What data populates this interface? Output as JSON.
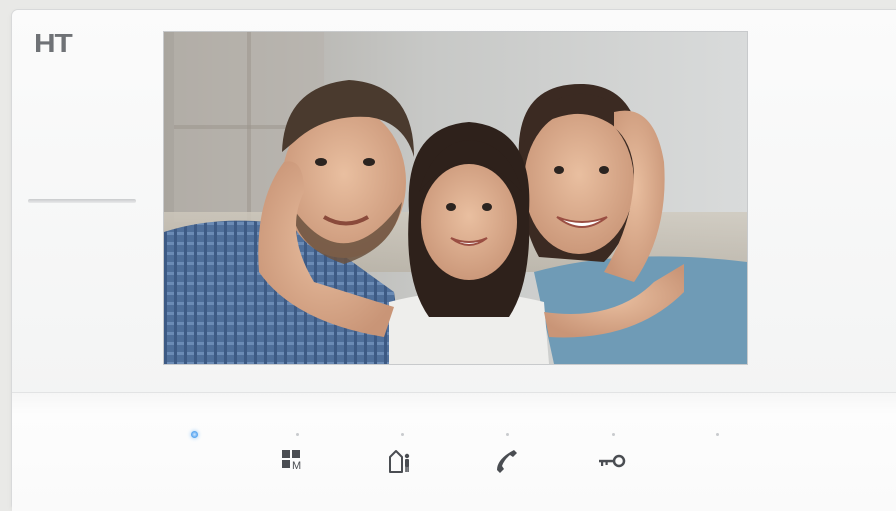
{
  "brand": {
    "logo_text": "HT"
  },
  "screen": {
    "content": "video-feed-family-photo"
  },
  "controls": {
    "indicator_led": {
      "state": "on",
      "color": "#4da3f0"
    },
    "buttons": [
      {
        "icon": "menu-grid-icon",
        "label": "M"
      },
      {
        "icon": "door-person-icon"
      },
      {
        "icon": "phone-handset-icon"
      },
      {
        "icon": "key-icon"
      }
    ]
  },
  "colors": {
    "device_body": "#f7f7f7",
    "icon": "#4a4d52",
    "led_active": "#4da3f0"
  }
}
